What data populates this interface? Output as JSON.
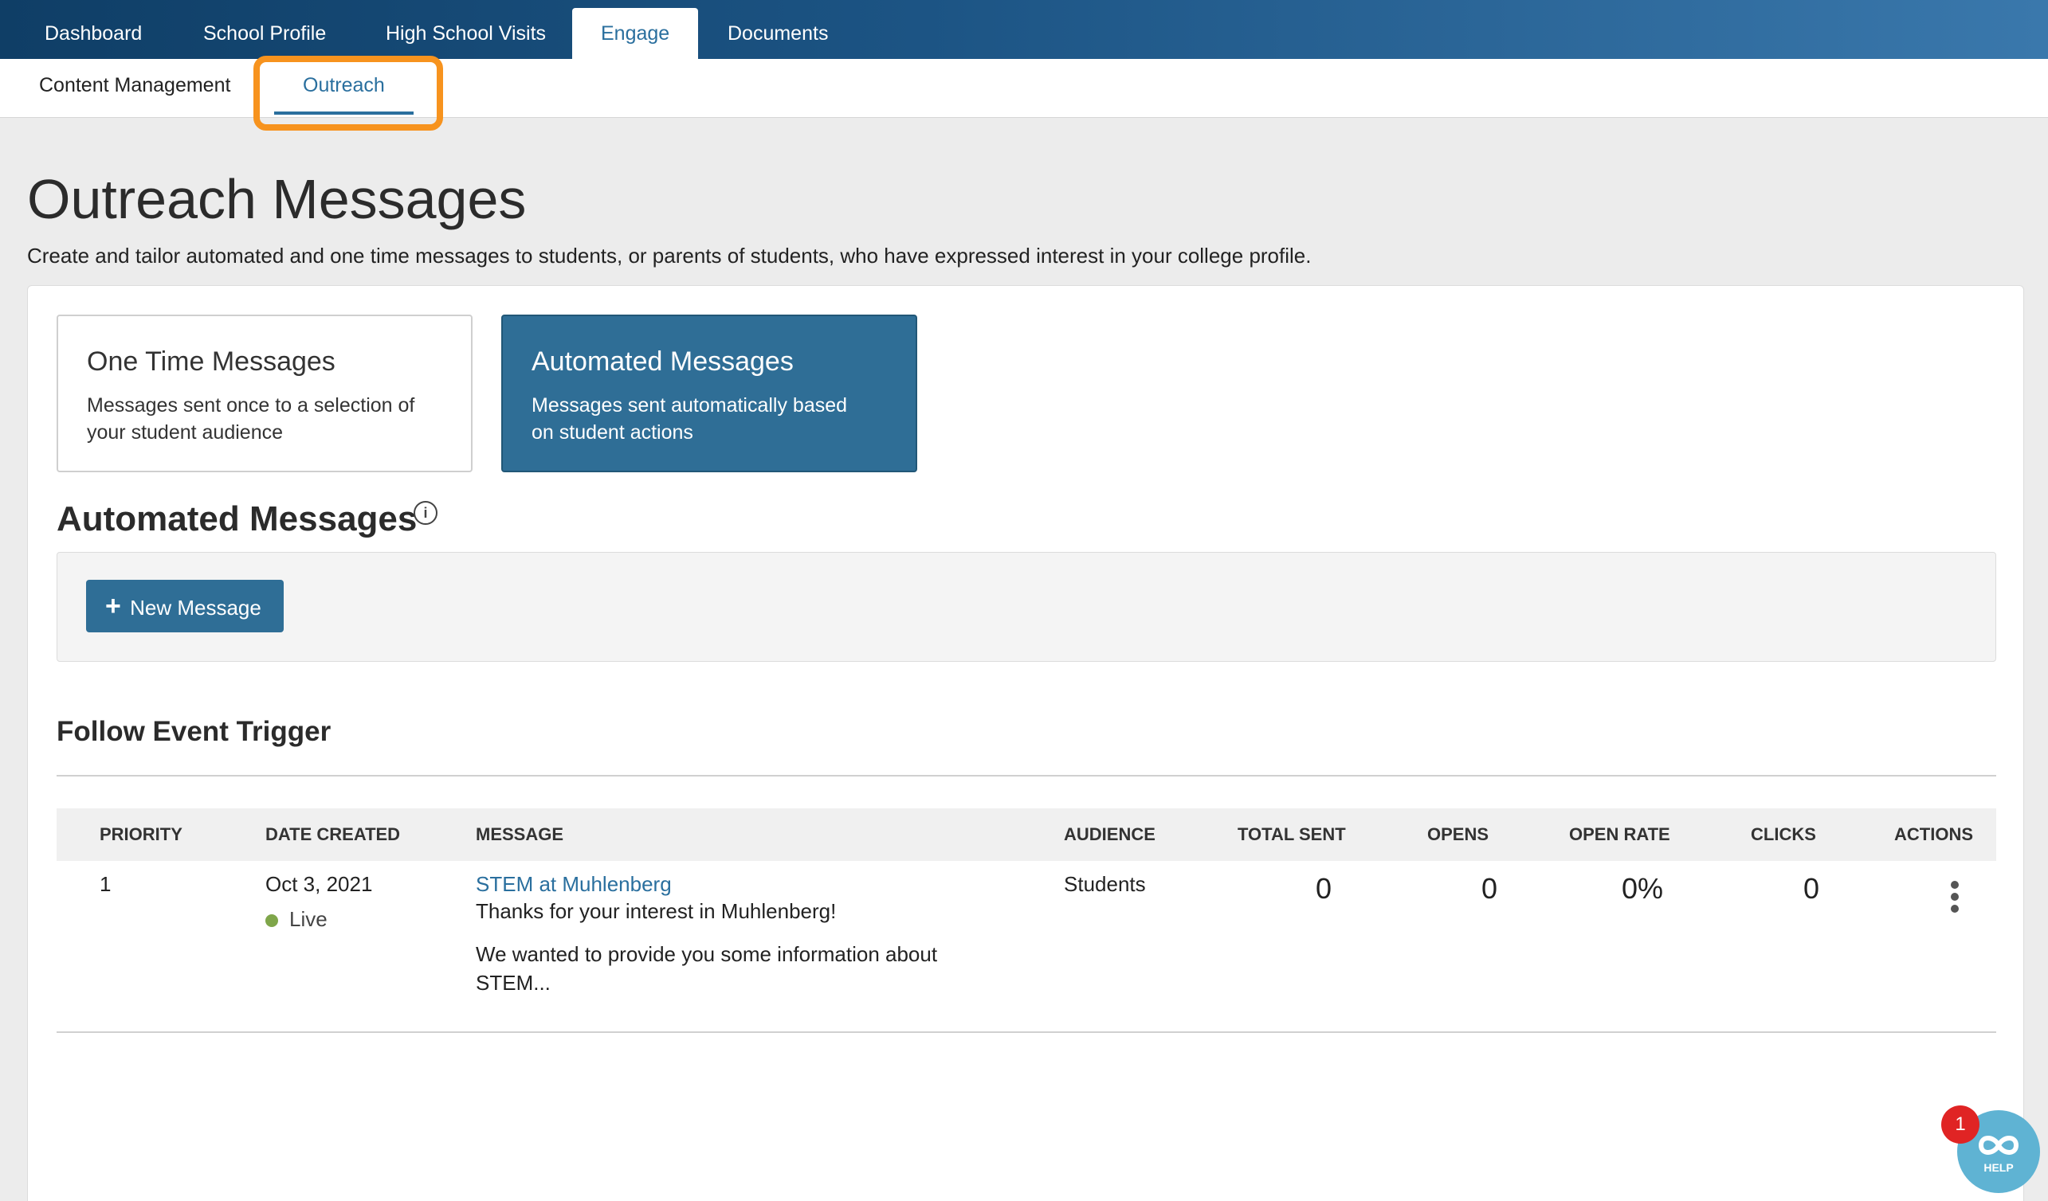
{
  "topnav": {
    "tabs": [
      {
        "label": "Dashboard"
      },
      {
        "label": "School Profile"
      },
      {
        "label": "High School Visits"
      },
      {
        "label": "Engage"
      },
      {
        "label": "Documents"
      }
    ]
  },
  "subnav": {
    "tabs": [
      {
        "label": "Content Management"
      },
      {
        "label": "Outreach"
      }
    ]
  },
  "page": {
    "title": "Outreach Messages",
    "description": "Create and tailor automated and one time messages to students, or parents of students, who have expressed interest in your college profile."
  },
  "cards": {
    "one_time": {
      "title": "One Time Messages",
      "desc_line1": "Messages sent once to a selection of",
      "desc_line2": "your student audience"
    },
    "automated": {
      "title": "Automated Messages",
      "desc_line1": "Messages sent automatically based",
      "desc_line2": "on student actions"
    }
  },
  "section": {
    "title": "Automated Messages",
    "info_icon": "info-circle-icon",
    "info_glyph": "i",
    "new_button": "New Message",
    "plus_glyph": "+"
  },
  "trigger": {
    "title": "Follow Event Trigger"
  },
  "table": {
    "headers": {
      "priority": "PRIORITY",
      "date_created": "DATE CREATED",
      "message": "MESSAGE",
      "audience": "AUDIENCE",
      "total_sent": "TOTAL SENT",
      "opens": "OPENS",
      "open_rate": "OPEN RATE",
      "clicks": "CLICKS",
      "actions": "ACTIONS"
    },
    "rows": [
      {
        "priority": "1",
        "date_created": "Oct 3, 2021",
        "status": "Live",
        "message_title": "STEM at Muhlenberg",
        "message_line1": "Thanks for your interest in Muhlenberg!",
        "message_line2": "We wanted to provide you some information about",
        "message_line3": "STEM...",
        "audience": "Students",
        "total_sent": "0",
        "opens": "0",
        "open_rate": "0%",
        "clicks": "0"
      }
    ]
  },
  "help": {
    "badge": "1",
    "label": "HELP"
  },
  "colors": {
    "accent": "#2a6f9e",
    "highlight": "#f7931e",
    "live": "#7fa64a",
    "badge": "#e02424"
  }
}
